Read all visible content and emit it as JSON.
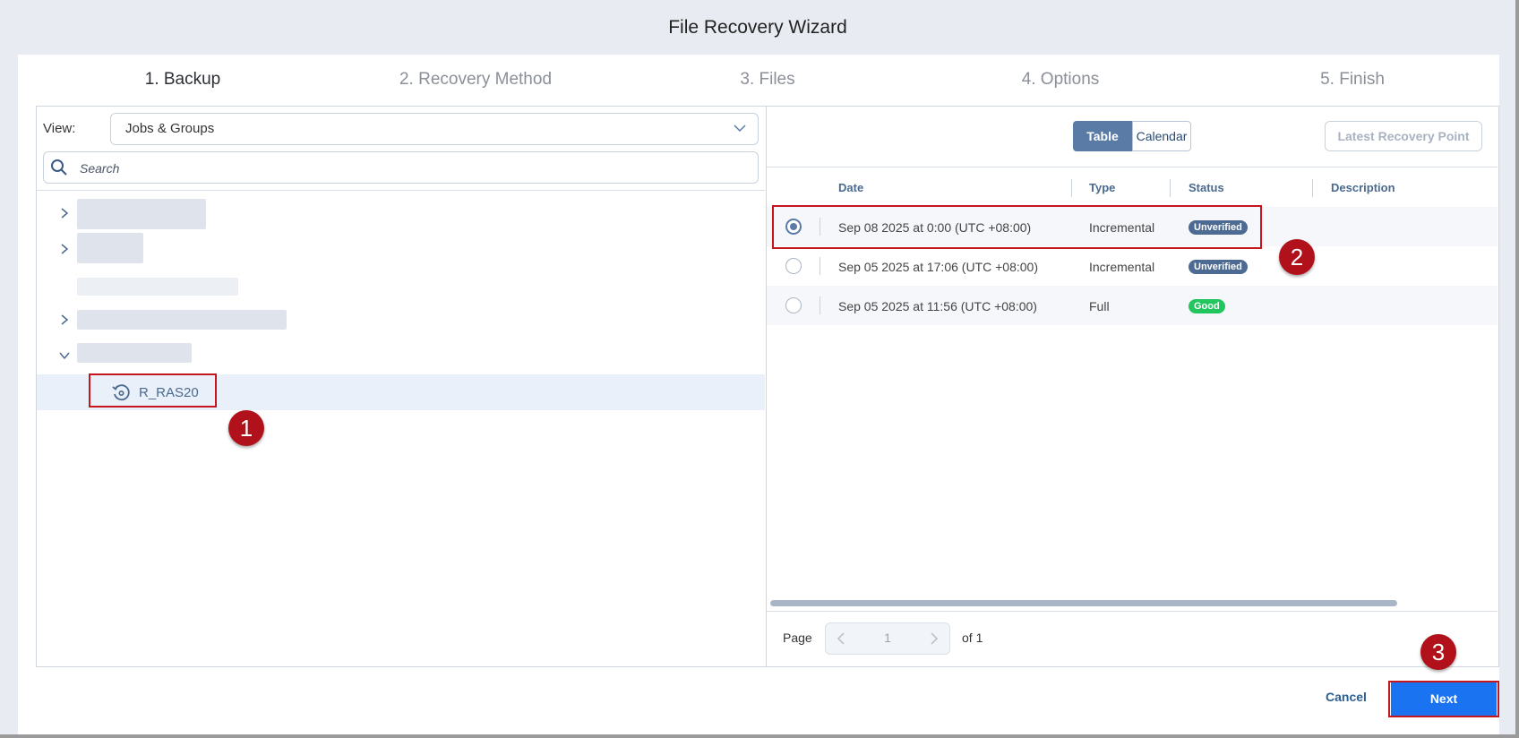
{
  "window": {
    "title": "File Recovery Wizard"
  },
  "steps": [
    {
      "label": "1. Backup"
    },
    {
      "label": "2. Recovery Method"
    },
    {
      "label": "3. Files"
    },
    {
      "label": "4. Options"
    },
    {
      "label": "5. Finish"
    }
  ],
  "active_step": 0,
  "left": {
    "view_label": "View:",
    "view_value": "Jobs & Groups",
    "search_placeholder": "Search",
    "selected_item": "R_RAS20"
  },
  "right": {
    "toggle": {
      "table": "Table",
      "calendar": "Calendar",
      "selected": "Table"
    },
    "latest_button": "Latest Recovery Point",
    "columns": [
      "Date",
      "Type",
      "Status",
      "Description"
    ],
    "rows": [
      {
        "date": "Sep 08 2025 at 0:00 (UTC +08:00)",
        "type": "Incremental",
        "status": "Unverified",
        "selected": true
      },
      {
        "date": "Sep 05 2025 at 17:06 (UTC +08:00)",
        "type": "Incremental",
        "status": "Unverified",
        "selected": false
      },
      {
        "date": "Sep 05 2025 at 11:56 (UTC +08:00)",
        "type": "Full",
        "status": "Good",
        "selected": false
      }
    ],
    "pager": {
      "label": "Page",
      "current": "1",
      "of": "of 1"
    }
  },
  "footer": {
    "cancel": "Cancel",
    "next": "Next"
  },
  "annotations": [
    "1",
    "2",
    "3"
  ],
  "colors": {
    "accent": "#1a73f0",
    "annotation_red": "#b0111a",
    "status_unverified": "#4d6b92",
    "status_good": "#22c55e"
  }
}
